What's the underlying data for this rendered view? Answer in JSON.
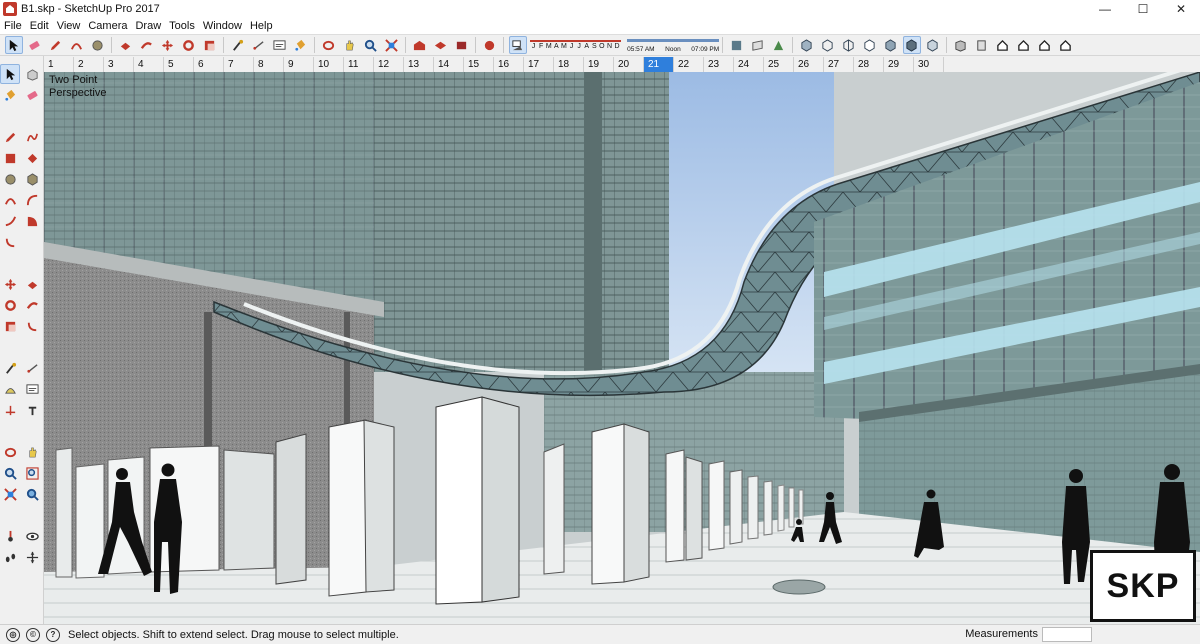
{
  "window": {
    "title": "B1.skp - SketchUp Pro 2017",
    "minimize_glyph": "—",
    "maximize_glyph": "☐",
    "close_glyph": "✕"
  },
  "menu": [
    "File",
    "Edit",
    "View",
    "Camera",
    "Draw",
    "Tools",
    "Window",
    "Help"
  ],
  "shadow_settings": {
    "months": [
      "J",
      "F",
      "M",
      "A",
      "M",
      "J",
      "J",
      "A",
      "S",
      "O",
      "N",
      "D"
    ],
    "time_start": "05:57 AM",
    "time_mid": "Noon",
    "time_end": "07:09 PM"
  },
  "scenes": [
    "1",
    "2",
    "3",
    "4",
    "5",
    "6",
    "7",
    "8",
    "9",
    "10",
    "11",
    "12",
    "13",
    "14",
    "15",
    "16",
    "17",
    "18",
    "19",
    "20",
    "21",
    "22",
    "23",
    "24",
    "25",
    "26",
    "27",
    "28",
    "29",
    "30"
  ],
  "active_scene": "21",
  "viewport": {
    "camera_label_line1": "Two Point",
    "camera_label_line2": "Perspective",
    "badge": "SKP"
  },
  "status": {
    "message": "Select objects. Shift to extend select. Drag mouse to select multiple.",
    "measurements_label": "Measurements",
    "measurements_value": ""
  },
  "colors": {
    "accent_active_scene": "#2f7fdc",
    "sky": "#a9c4e6",
    "glass": "#7e9c9c"
  }
}
